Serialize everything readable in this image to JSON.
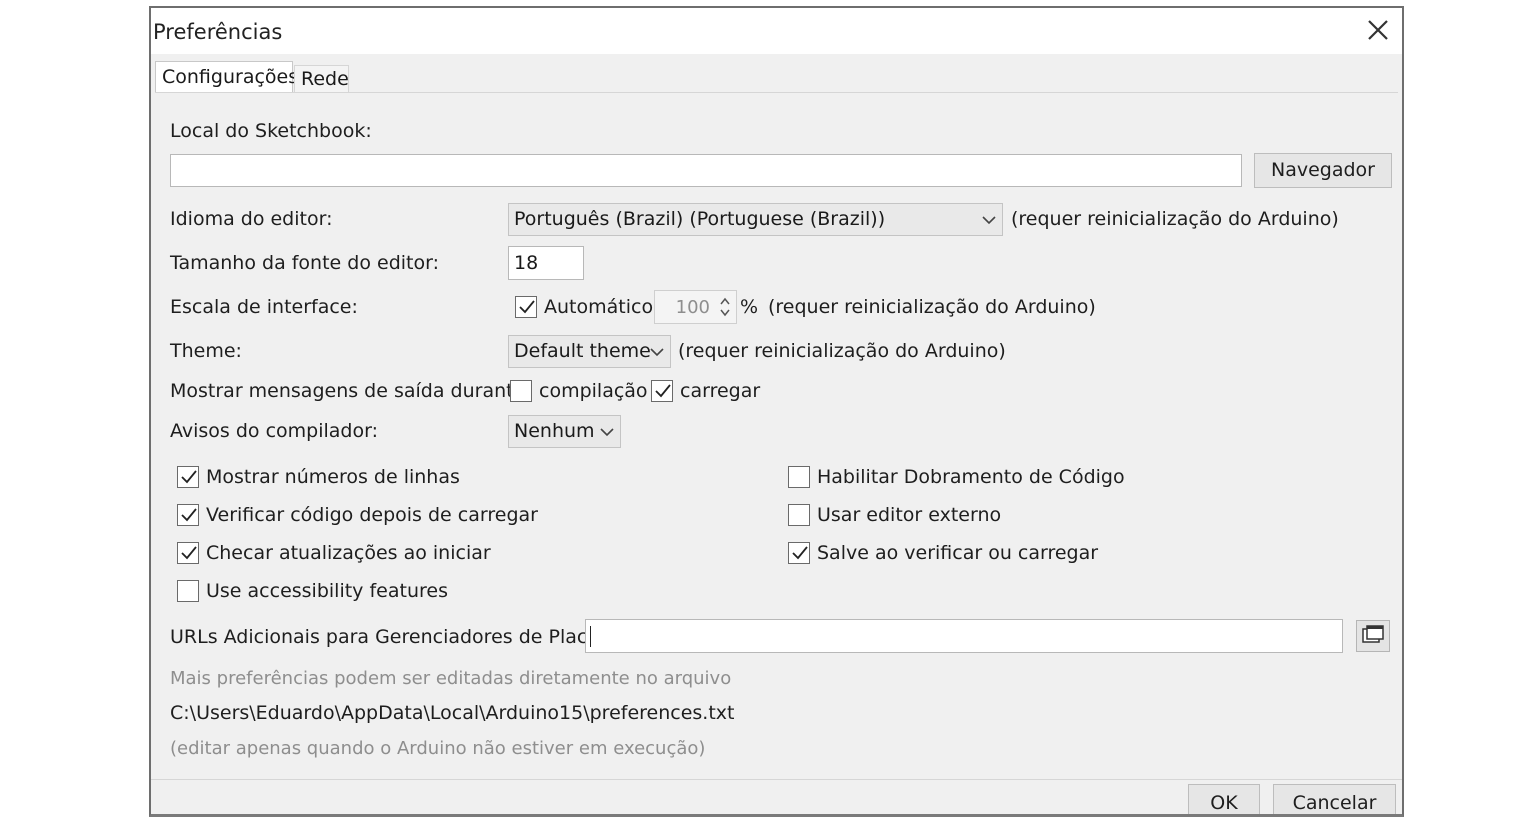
{
  "window": {
    "title": "Preferências"
  },
  "tabs": [
    {
      "label": "Configurações",
      "active": true
    },
    {
      "label": "Rede",
      "active": false
    }
  ],
  "settings": {
    "sketchbook_label": "Local do Sketchbook:",
    "sketchbook_value": "",
    "browse_button": "Navegador",
    "language_label": "Idioma do editor:",
    "language_value": "Português (Brazil) (Portuguese (Brazil))",
    "restart_note": "(requer reinicialização do Arduino)",
    "font_size_label": "Tamanho da fonte do editor:",
    "font_size_value": "18",
    "scale_label": "Escala de interface:",
    "scale_auto_label": "Automático",
    "scale_auto_checked": true,
    "scale_value": "100",
    "scale_unit": "%",
    "theme_label": "Theme:",
    "theme_value": "Default theme",
    "output_label": "Mostrar mensagens de saída durante:",
    "output_compile_label": "compilação",
    "output_compile_checked": false,
    "output_upload_label": "carregar",
    "output_upload_checked": true,
    "warnings_label": "Avisos do compilador:",
    "warnings_value": "Nenhum"
  },
  "options_left": [
    {
      "label": "Mostrar números de linhas",
      "checked": true
    },
    {
      "label": "Verificar código depois de carregar",
      "checked": true
    },
    {
      "label": "Checar atualizações ao iniciar",
      "checked": true
    },
    {
      "label": "Use accessibility features",
      "checked": false
    }
  ],
  "options_right": [
    {
      "label": "Habilitar Dobramento de Código",
      "checked": false
    },
    {
      "label": "Usar editor externo",
      "checked": false
    },
    {
      "label": "Salve ao verificar ou carregar",
      "checked": true
    }
  ],
  "urls": {
    "label": "URLs Adicionais para Gerenciadores de Placas:",
    "value": ""
  },
  "info": {
    "more_prefs": "Mais preferências podem ser editadas diretamente no arquivo",
    "path": "C:\\Users\\Eduardo\\AppData\\Local\\Arduino15\\preferences.txt",
    "edit_note": "(editar apenas quando o Arduino não estiver em execução)"
  },
  "footer": {
    "ok_label": "OK",
    "cancel_label": "Cancelar"
  },
  "colors": {
    "dialog_bg": "#f0f0f0",
    "field_bg": "#ffffff",
    "muted_text": "#8e8e8e"
  },
  "icons": {
    "close": "close-icon",
    "dropdown": "chevron-down-icon",
    "check": "check-icon",
    "spinner": "spinner-arrows-icon",
    "expand": "window-expand-icon"
  }
}
